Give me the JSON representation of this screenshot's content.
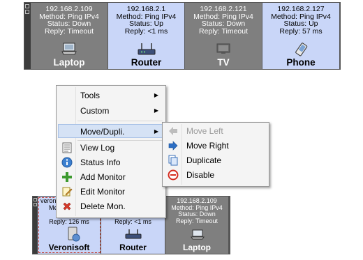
{
  "top_row": {
    "tiles": [
      {
        "ip": "192.168.2.109",
        "method": "Method: Ping IPv4",
        "status": "Status: Down",
        "reply": "Reply: Timeout",
        "name": "Laptop",
        "icon": "laptop-icon",
        "state": "down"
      },
      {
        "ip": "192.168.2.1",
        "method": "Method: Ping IPv4",
        "status": "Status: Up",
        "reply": "Reply: <1 ms",
        "name": "Router",
        "icon": "router-icon",
        "state": "up"
      },
      {
        "ip": "192.168.2.121",
        "method": "Method: Ping IPv4",
        "status": "Status: Down",
        "reply": "Reply: Timeout",
        "name": "TV",
        "icon": "tv-icon",
        "state": "down"
      },
      {
        "ip": "192.168.2.127",
        "method": "Method: Ping IPv4",
        "status": "Status: Up",
        "reply": "Reply: 57 ms",
        "name": "Phone",
        "icon": "phone-icon",
        "state": "up"
      }
    ]
  },
  "bottom_row": {
    "tiles": [
      {
        "top_text": "veron",
        "method_partial": "Met",
        "reply": "Reply: 126 ms",
        "name": "Veronisoft",
        "icon": "server-icon",
        "state": "up"
      },
      {
        "reply": "Reply: <1 ms",
        "name": "Router",
        "icon": "router-icon",
        "state": "up"
      },
      {
        "ip": "192.168.2.109",
        "method": "Method: Ping IPv4",
        "status": "Status: Down",
        "reply": "Reply: Timeout",
        "name": "Laptop",
        "icon": "laptop-icon",
        "state": "down"
      }
    ]
  },
  "context_menu": {
    "tools": "Tools",
    "custom": "Custom",
    "move_dupli": "Move/Dupli.",
    "view_log": "View Log",
    "status_info": "Status Info",
    "add_monitor": "Add Monitor",
    "edit_monitor": "Edit Monitor",
    "delete_mon": "Delete Mon.",
    "submenu_arrow": "▶"
  },
  "submenu": {
    "move_left": "Move Left",
    "move_right": "Move Right",
    "duplicate": "Duplicate",
    "disable": "Disable"
  },
  "colors": {
    "down": "#7f7f7f",
    "up": "#c9d6f8",
    "menu_highlight": "#d5e2f5"
  }
}
